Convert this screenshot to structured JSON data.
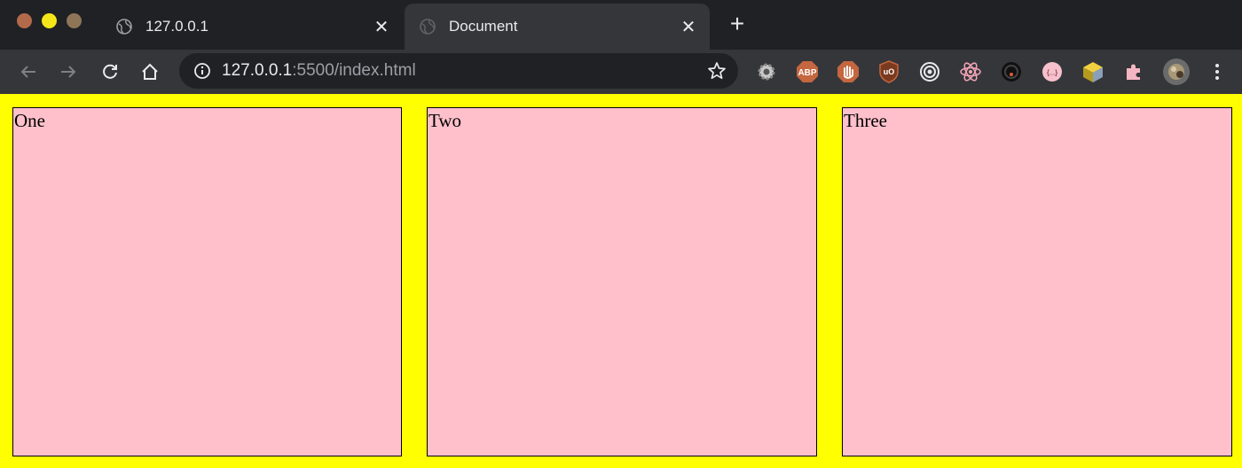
{
  "window": {
    "colors": {
      "frame": "#202124",
      "toolbar": "#35363a",
      "page_bg": "#ffff00",
      "box_bg": "#ffc0cb"
    }
  },
  "tabs": [
    {
      "title": "127.0.0.1",
      "close": "✕",
      "favicon": "globe-icon",
      "active": false
    },
    {
      "title": "Document",
      "close": "✕",
      "favicon": "loading-globe-icon",
      "active": true
    }
  ],
  "new_tab_label": "+",
  "toolbar": {
    "url_host": "127.0.0.1",
    "url_rest": ":5500/index.html",
    "extensions": [
      "gear-extension-icon",
      "abp-extension-icon",
      "hand-stop-extension-icon",
      "ublock-extension-icon",
      "target-extension-icon",
      "react-devtools-icon",
      "record-extension-icon",
      "json-formatter-icon",
      "cube-extension-icon",
      "puzzle-extensions-icon",
      "profile-avatar",
      "kebab-menu-icon"
    ],
    "abp_label": "ABP",
    "json_label": "{...}"
  },
  "page": {
    "boxes": [
      {
        "label": "One"
      },
      {
        "label": "Two"
      },
      {
        "label": "Three"
      }
    ]
  }
}
